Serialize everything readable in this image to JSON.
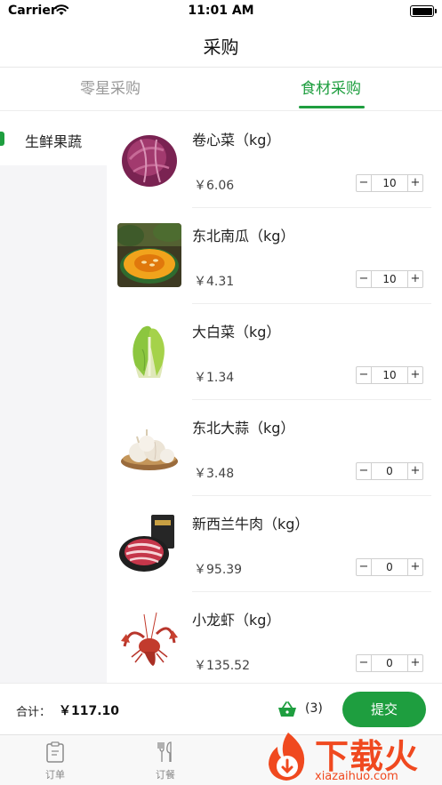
{
  "status_bar": {
    "carrier": "Carrier",
    "time": "11:01 AM"
  },
  "nav": {
    "title": "采购"
  },
  "tabs": [
    {
      "label": "零星采购",
      "active": false
    },
    {
      "label": "食材采购",
      "active": true
    }
  ],
  "sidebar": {
    "items": [
      {
        "label": "生鲜果蔬",
        "active": true
      }
    ]
  },
  "products": [
    {
      "name": "卷心菜（kg）",
      "price": "￥6.06",
      "qty": "10",
      "image_icon": "red-cabbage-image"
    },
    {
      "name": "东北南瓜（kg）",
      "price": "￥4.31",
      "qty": "10",
      "image_icon": "pumpkin-image"
    },
    {
      "name": "大白菜（kg）",
      "price": "￥1.34",
      "qty": "10",
      "image_icon": "napa-cabbage-image"
    },
    {
      "name": "东北大蒜（kg）",
      "price": "￥3.48",
      "qty": "0",
      "image_icon": "garlic-image"
    },
    {
      "name": "新西兰牛肉（kg）",
      "price": "￥95.39",
      "qty": "0",
      "image_icon": "beef-image"
    },
    {
      "name": "小龙虾（kg）",
      "price": "￥135.52",
      "qty": "0",
      "image_icon": "crayfish-image"
    }
  ],
  "stepper": {
    "minus": "−",
    "plus": "+"
  },
  "footer": {
    "total_label": "合计：",
    "total_value": "￥117.10",
    "basket_count": "(3)",
    "submit_label": "提交"
  },
  "tabbar": [
    {
      "label": "订单",
      "icon": "clipboard-icon"
    },
    {
      "label": "订餐",
      "icon": "fork-knife-icon"
    }
  ],
  "watermark": {
    "text": "下载火",
    "sub": "xiazaihuo.com"
  },
  "colors": {
    "accent": "#1e9e3f",
    "watermark": "#f0491f",
    "sidebar_bg": "#f5f5f7"
  }
}
